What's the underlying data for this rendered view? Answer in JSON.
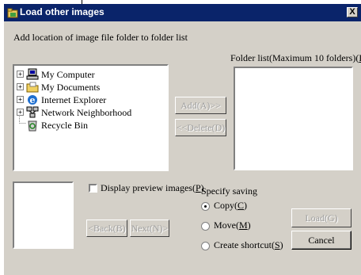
{
  "window": {
    "title": "Load other images",
    "close_label": "X",
    "icon": "folder-app-icon"
  },
  "instructions": "Add location of image file folder to folder list",
  "tree": {
    "items": [
      {
        "label": "My Computer",
        "icon": "computer-icon",
        "expander": "+"
      },
      {
        "label": "My Documents",
        "icon": "folder-icon",
        "expander": "+"
      },
      {
        "label": "Internet Explorer",
        "icon": "ie-icon",
        "expander": "+"
      },
      {
        "label": "Network Neighborhood",
        "icon": "network-icon",
        "expander": "+"
      },
      {
        "label": "Recycle Bin",
        "icon": "recycle-bin-icon",
        "expander": ""
      }
    ]
  },
  "folder_list": {
    "label_prefix": "Folder list(Maximum 10 folders)(",
    "label_key": "L",
    "label_suffix": ")"
  },
  "buttons": {
    "add": "Add(A)>>",
    "delete": "<<Delete(D)",
    "back": "<Back(B)",
    "next": "Next(N)>",
    "load": "Load(G)",
    "cancel": "Cancel"
  },
  "preview": {
    "label_prefix": "Display preview images(",
    "label_key": "P",
    "label_suffix": ")",
    "checked": false
  },
  "saving": {
    "heading": "Specify saving",
    "options": [
      {
        "prefix": "Copy(",
        "key": "C",
        "suffix": ")",
        "selected": true
      },
      {
        "prefix": "Move(",
        "key": "M",
        "suffix": ")",
        "selected": false
      },
      {
        "prefix": "Create shortcut(",
        "key": "S",
        "suffix": ")",
        "selected": false
      }
    ]
  },
  "colors": {
    "titlebar": "#0a246a",
    "face": "#d4d0c8"
  }
}
